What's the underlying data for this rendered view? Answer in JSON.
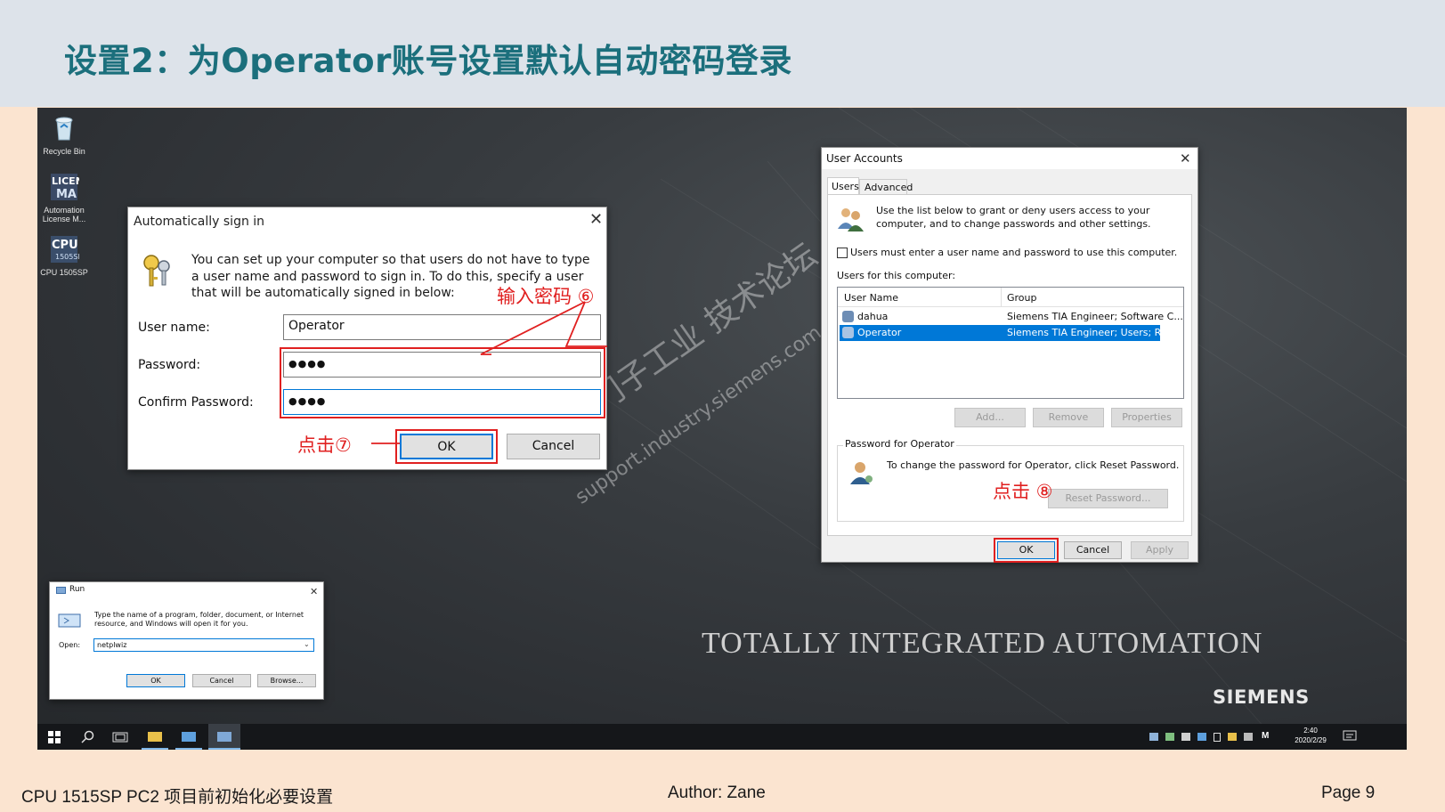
{
  "slide": {
    "title": "设置2：为Operator账号设置默认自动密码登录",
    "footer_left": "CPU 1515SP PC2 项目前初始化必要设置",
    "footer_center": "Author:  Zane",
    "footer_right": "Page  9"
  },
  "desktop": {
    "icons": [
      {
        "label": "Recycle Bin",
        "icon": "recycle-bin-icon"
      },
      {
        "label": "Automation License M...",
        "icon": "license-manager-icon"
      },
      {
        "label": "CPU 1505SP",
        "icon": "cpu-1505sp-icon"
      }
    ],
    "banner": "TOTALLY INTEGRATED AUTOMATION",
    "logo": "SIEMENS",
    "watermark_cn": "西门子工业 技术论坛",
    "watermark_url": "support.industry.siemens.com"
  },
  "auto_signin": {
    "title": "Automatically sign in",
    "description": "You can set up your computer so that users do not have to type a user name and password to sign in. To do this, specify a user that will be automatically signed in below:",
    "username_label": "User name:",
    "username_value": "Operator",
    "password_label": "Password:",
    "password_value": "●●●●",
    "confirm_label": "Confirm Password:",
    "confirm_value": "●●●●",
    "ok": "OK",
    "cancel": "Cancel"
  },
  "annotations": {
    "enter_password": "输入密码 ⑥",
    "click7": "点击⑦",
    "click8": "点击 ⑧"
  },
  "user_accounts": {
    "title": "User Accounts",
    "tabs": [
      "Users",
      "Advanced"
    ],
    "intro": "Use the list below to grant or deny users access to your computer, and to change passwords and other settings.",
    "must_enter": "Users must enter a user name and password to use this computer.",
    "users_for": "Users for this computer:",
    "columns": [
      "User Name",
      "Group"
    ],
    "rows": [
      {
        "name": "dahua",
        "group": "Siemens TIA Engineer; Software C..."
      },
      {
        "name": "Operator",
        "group": "Siemens TIA Engineer; Users; Re..."
      }
    ],
    "add": "Add...",
    "remove": "Remove",
    "properties": "Properties",
    "pw_group": "Password for Operator",
    "pw_text": "To change the password for Operator, click Reset Password.",
    "reset": "Reset Password...",
    "ok": "OK",
    "cancel": "Cancel",
    "apply": "Apply"
  },
  "run": {
    "title": "Run",
    "text": "Type the name of a program, folder, document, or Internet resource, and Windows will open it for you.",
    "open_label": "Open:",
    "open_value": "netplwiz",
    "ok": "OK",
    "cancel": "Cancel",
    "browse": "Browse..."
  },
  "taskbar": {
    "time": "2:40",
    "date": "2020/2/29",
    "ime": "M"
  },
  "colors": {
    "title_teal": "#1b6f7c",
    "annotation_red": "#e02020",
    "selection_blue": "#0078d7",
    "slide_background": "#fbe4d0",
    "header_background": "#dde3ea"
  }
}
